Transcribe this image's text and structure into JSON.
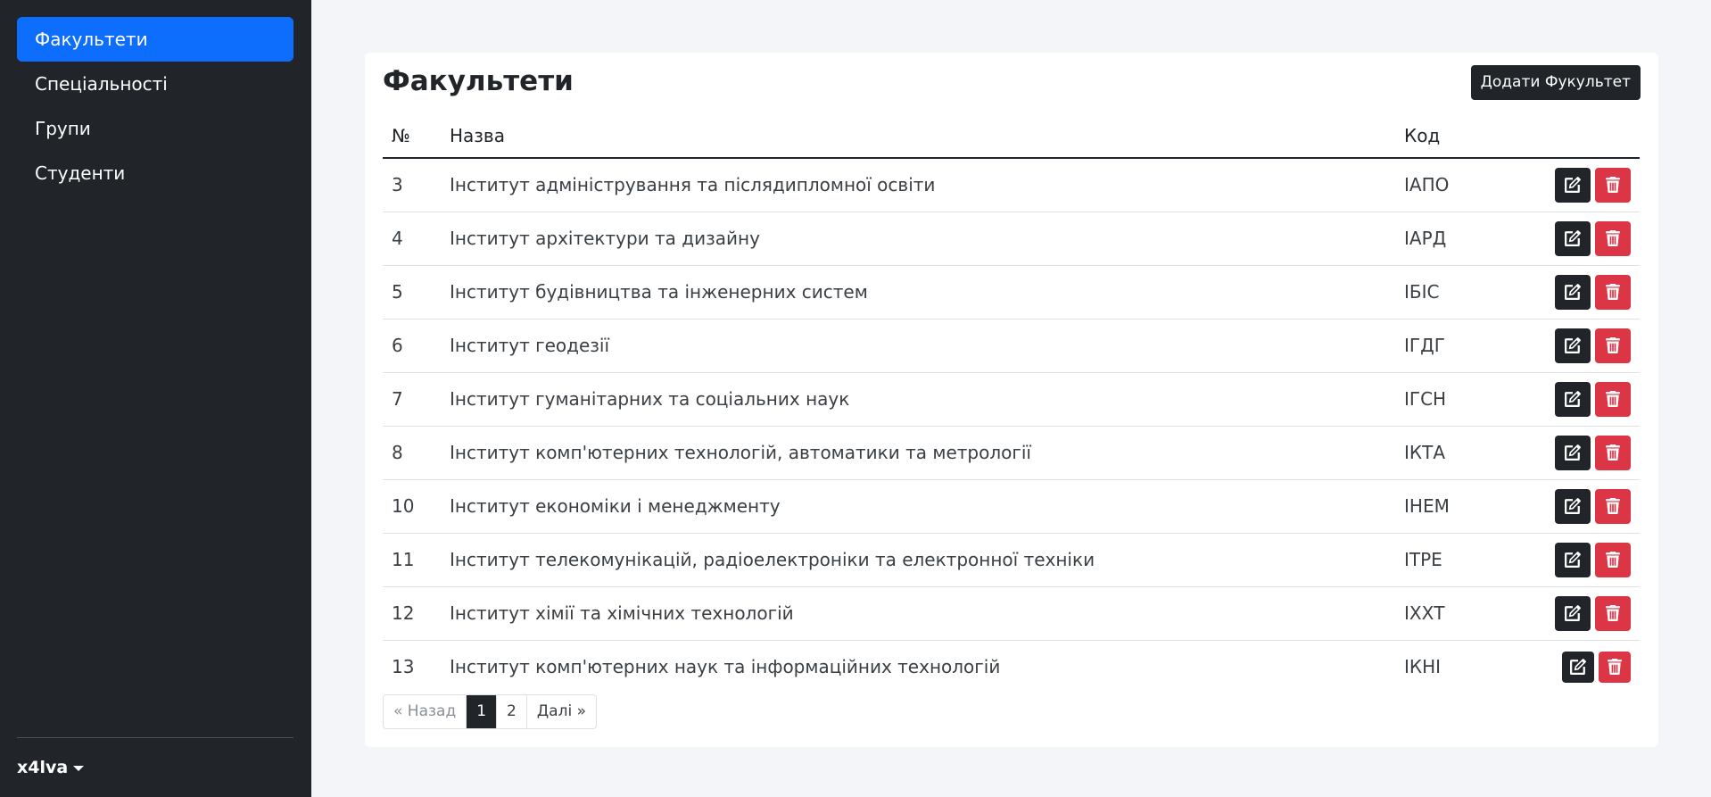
{
  "sidebar": {
    "items": [
      {
        "label": "Факультети"
      },
      {
        "label": "Спеціальності"
      },
      {
        "label": "Групи"
      },
      {
        "label": "Студенти"
      }
    ],
    "user": "x4lva"
  },
  "main": {
    "title": "Факультети",
    "add_button": "Додати Фукультет",
    "headers": {
      "num": "№",
      "name": "Назва",
      "code": "Код"
    },
    "rows": [
      {
        "num": "3",
        "name": "Інститут адміністрування та післядипломної освіти",
        "code": "ІАПО"
      },
      {
        "num": "4",
        "name": "Інститут архітектури та дизайну",
        "code": "ІАРД"
      },
      {
        "num": "5",
        "name": "Інститут будівництва та інженерних систем",
        "code": "ІБІС"
      },
      {
        "num": "6",
        "name": "Інститут геодезії",
        "code": "ІГДГ"
      },
      {
        "num": "7",
        "name": "Інститут гуманітарних та соціальних наук",
        "code": "ІГСН"
      },
      {
        "num": "8",
        "name": "Інститут комп'ютерних технологій, автоматики та метрології",
        "code": "ІКТА"
      },
      {
        "num": "10",
        "name": "Інститут економіки і менеджменту",
        "code": "ІНЕМ"
      },
      {
        "num": "11",
        "name": "Інститут телекомунікацій, радіоелектроніки та електронної техніки",
        "code": "ІТРЕ"
      },
      {
        "num": "12",
        "name": "Інститут хімії та хімічних технологій",
        "code": "ІХХТ"
      },
      {
        "num": "13",
        "name": "Інститут комп'ютерних наук та інформаційних технологій",
        "code": "ІКНІ"
      }
    ],
    "pagination": {
      "prev": "« Назад",
      "pages": [
        "1",
        "2"
      ],
      "next": "Далі »"
    }
  },
  "colors": {
    "accent": "#0d6efd",
    "dark": "#212529",
    "danger": "#dc3545"
  },
  "icons": {
    "edit": "edit-icon",
    "delete": "trash-icon",
    "user_menu": "caret-down-icon"
  }
}
